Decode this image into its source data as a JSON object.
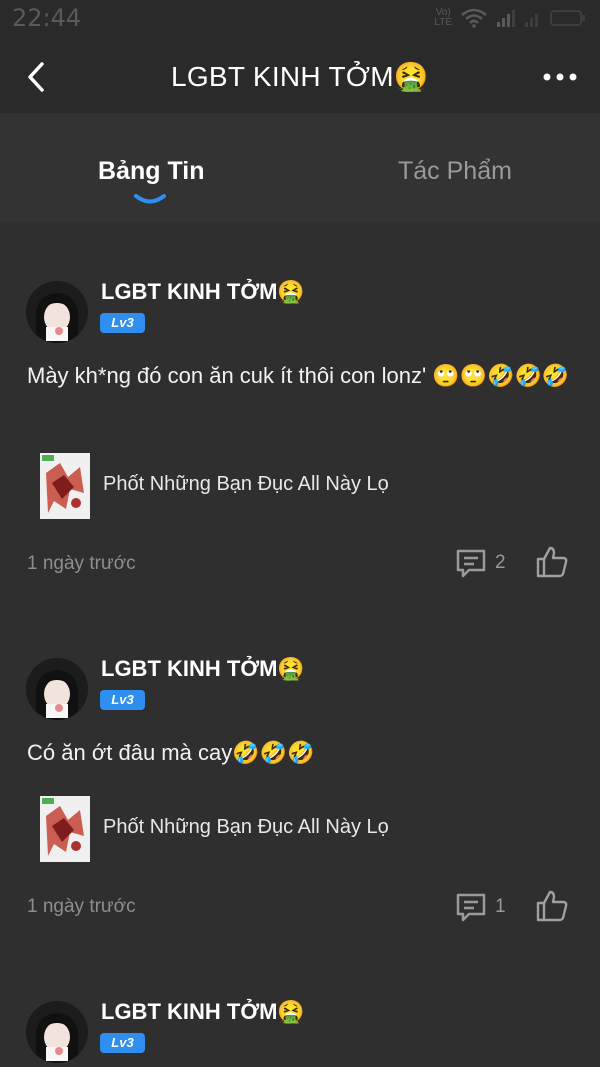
{
  "status": {
    "time": "22:44",
    "network_label": "Vo)\nLTE"
  },
  "header": {
    "title": "LGBT KINH TỞM🤮",
    "back_icon": "chevron-left-icon",
    "more_icon": "more-horizontal-icon"
  },
  "tabs": [
    {
      "label": "Bảng Tin",
      "active": true
    },
    {
      "label": "Tác Phẩm",
      "active": false
    }
  ],
  "colors": {
    "background": "#2f2f2f",
    "bar": "#2a2a2a",
    "accent": "#2f8ff0",
    "muted": "#8e8e8e"
  },
  "posts": [
    {
      "author": "LGBT KINH TỞM🤮",
      "level": "Lv3",
      "text": "Mày kh*ng đó con ăn cuk ít thôi con lonz' 🙄🙄🤣🤣🤣",
      "work_title": "Phốt Những Bạn Đục All Này Lọ",
      "time": "1 ngày trước",
      "comments": "2"
    },
    {
      "author": "LGBT KINH TỞM🤮",
      "level": "Lv3",
      "text": "Có ăn ớt đâu mà cay🤣🤣🤣",
      "work_title": "Phốt Những Bạn Đục All Này Lọ",
      "time": "1 ngày trước",
      "comments": "1"
    },
    {
      "author": "LGBT KINH TỞM🤮",
      "level": "Lv3"
    }
  ]
}
